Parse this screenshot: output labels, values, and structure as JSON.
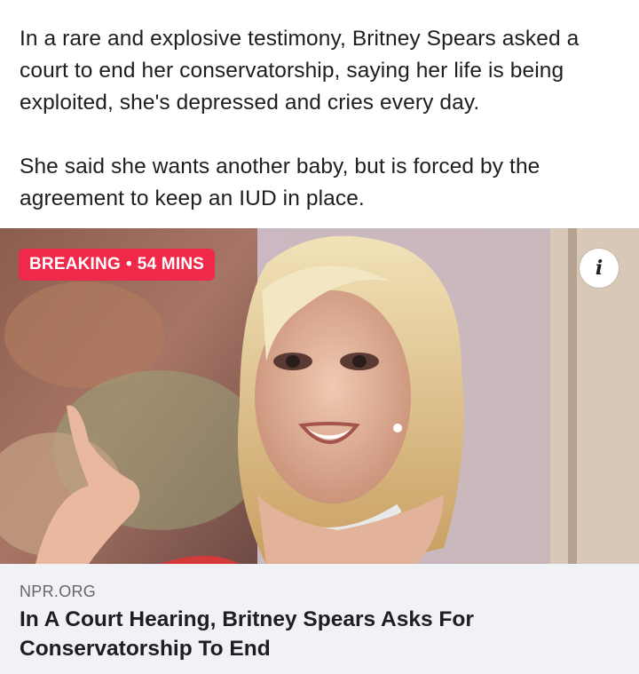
{
  "post": {
    "paragraph_1": "In a rare and explosive testimony, Britney Spears asked a court to end her conservatorship, saying her life is being exploited, she's depressed and cries every day.",
    "paragraph_2": "She said she wants another baby, but is forced by the agreement to keep an IUD in place."
  },
  "badge": {
    "label": "BREAKING",
    "separator": "•",
    "time": "54 MINS",
    "color": "#f02849"
  },
  "info_button": {
    "icon": "info-icon",
    "glyph": "i"
  },
  "link_preview": {
    "domain": "NPR.ORG",
    "title": "In A Court Hearing, Britney Spears Asks For Conservatorship To End",
    "background": "#f0f2f5"
  }
}
